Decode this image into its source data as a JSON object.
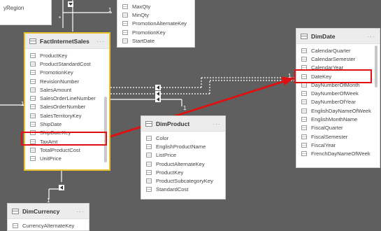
{
  "region_fragment": "yRegion",
  "cardinality": {
    "many": "*",
    "one": "1"
  },
  "tables": {
    "top_partial": {
      "fields": [
        "MaxQty",
        "MinQty",
        "PromotionAlternateKey",
        "PromotionKey",
        "StartDate"
      ]
    },
    "fact": {
      "title": "FactInternetSales",
      "more": "···",
      "fields": [
        "ProductKey",
        "ProductStandardCost",
        "PromotionKey",
        "RevisionNumber",
        "SalesAmount",
        "SalesOrderLineNumber",
        "SalesOrderNumber",
        "SalesTerritoryKey",
        "ShipDate",
        "ShipDateKey",
        "TaxAmt",
        "TotalProductCost",
        "UnitPrice"
      ]
    },
    "product": {
      "title": "DimProduct",
      "more": "···",
      "fields": [
        "Color",
        "EnglishProductName",
        "ListPrice",
        "ProductAlternateKey",
        "ProductKey",
        "ProductSubcategoryKey",
        "StandardCost"
      ]
    },
    "date": {
      "title": "DimDate",
      "more": "···",
      "fields": [
        "CalendarQuarter",
        "CalendarSemester",
        "CalendarYear",
        "DateKey",
        "DayNumberOfMonth",
        "DayNumberOfWeek",
        "DayNumberOfYear",
        "EnglishDayNameOfWeek",
        "EnglishMonthName",
        "FiscalQuarter",
        "FiscalSemester",
        "FiscalYear",
        "FrenchDayNameOfWeek"
      ]
    },
    "currency": {
      "title": "DimCurrency",
      "more": "···",
      "fields": [
        "CurrencyAlternateKey"
      ]
    }
  },
  "colors": {
    "canvas": "#5f5f5f",
    "selected_border": "#e8c030",
    "annotation": "#e01010"
  }
}
